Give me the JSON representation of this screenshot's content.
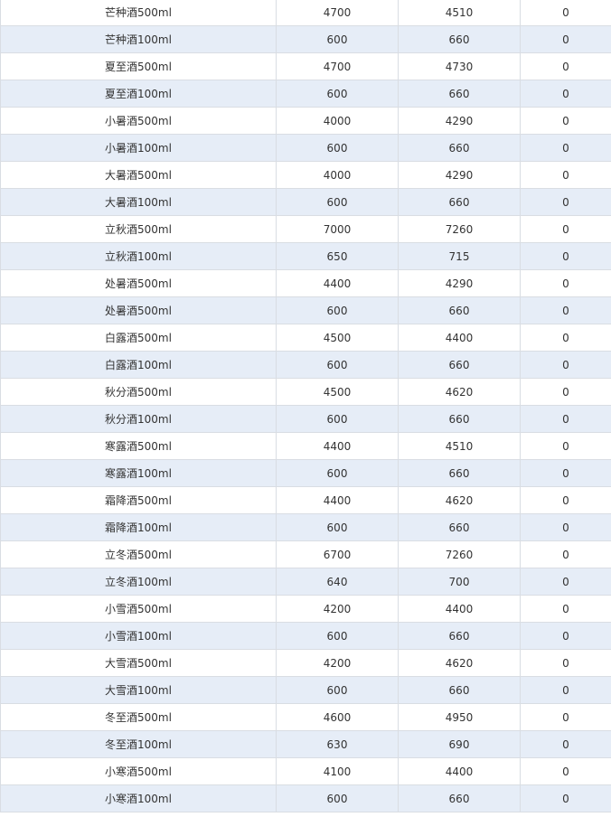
{
  "table": {
    "rows": [
      {
        "name": "芒种酒500ml",
        "v1": "4700",
        "v2": "4510",
        "v3": "0"
      },
      {
        "name": "芒种酒100ml",
        "v1": "600",
        "v2": "660",
        "v3": "0"
      },
      {
        "name": "夏至酒500ml",
        "v1": "4700",
        "v2": "4730",
        "v3": "0"
      },
      {
        "name": "夏至酒100ml",
        "v1": "600",
        "v2": "660",
        "v3": "0"
      },
      {
        "name": "小暑酒500ml",
        "v1": "4000",
        "v2": "4290",
        "v3": "0"
      },
      {
        "name": "小暑酒100ml",
        "v1": "600",
        "v2": "660",
        "v3": "0"
      },
      {
        "name": "大暑酒500ml",
        "v1": "4000",
        "v2": "4290",
        "v3": "0"
      },
      {
        "name": "大暑酒100ml",
        "v1": "600",
        "v2": "660",
        "v3": "0"
      },
      {
        "name": "立秋酒500ml",
        "v1": "7000",
        "v2": "7260",
        "v3": "0"
      },
      {
        "name": "立秋酒100ml",
        "v1": "650",
        "v2": "715",
        "v3": "0"
      },
      {
        "name": "处暑酒500ml",
        "v1": "4400",
        "v2": "4290",
        "v3": "0"
      },
      {
        "name": "处暑酒500ml",
        "v1": "600",
        "v2": "660",
        "v3": "0"
      },
      {
        "name": "白露酒500ml",
        "v1": "4500",
        "v2": "4400",
        "v3": "0"
      },
      {
        "name": "白露酒100ml",
        "v1": "600",
        "v2": "660",
        "v3": "0"
      },
      {
        "name": "秋分酒500ml",
        "v1": "4500",
        "v2": "4620",
        "v3": "0"
      },
      {
        "name": "秋分酒100ml",
        "v1": "600",
        "v2": "660",
        "v3": "0"
      },
      {
        "name": "寒露酒500ml",
        "v1": "4400",
        "v2": "4510",
        "v3": "0"
      },
      {
        "name": "寒露酒100ml",
        "v1": "600",
        "v2": "660",
        "v3": "0"
      },
      {
        "name": "霜降酒500ml",
        "v1": "4400",
        "v2": "4620",
        "v3": "0"
      },
      {
        "name": "霜降酒100ml",
        "v1": "600",
        "v2": "660",
        "v3": "0"
      },
      {
        "name": "立冬酒500ml",
        "v1": "6700",
        "v2": "7260",
        "v3": "0"
      },
      {
        "name": "立冬酒100ml",
        "v1": "640",
        "v2": "700",
        "v3": "0"
      },
      {
        "name": "小雪酒500ml",
        "v1": "4200",
        "v2": "4400",
        "v3": "0"
      },
      {
        "name": "小雪酒100ml",
        "v1": "600",
        "v2": "660",
        "v3": "0"
      },
      {
        "name": "大雪酒500ml",
        "v1": "4200",
        "v2": "4620",
        "v3": "0"
      },
      {
        "name": "大雪酒100ml",
        "v1": "600",
        "v2": "660",
        "v3": "0"
      },
      {
        "name": "冬至酒500ml",
        "v1": "4600",
        "v2": "4950",
        "v3": "0"
      },
      {
        "name": "冬至酒100ml",
        "v1": "630",
        "v2": "690",
        "v3": "0"
      },
      {
        "name": "小寒酒500ml",
        "v1": "4100",
        "v2": "4400",
        "v3": "0"
      },
      {
        "name": "小寒酒100ml",
        "v1": "600",
        "v2": "660",
        "v3": "0"
      }
    ]
  },
  "colors": {
    "row_stripe": "#e6edf7",
    "row_plain": "#ffffff",
    "border": "#d9dde3",
    "text": "#333333"
  }
}
